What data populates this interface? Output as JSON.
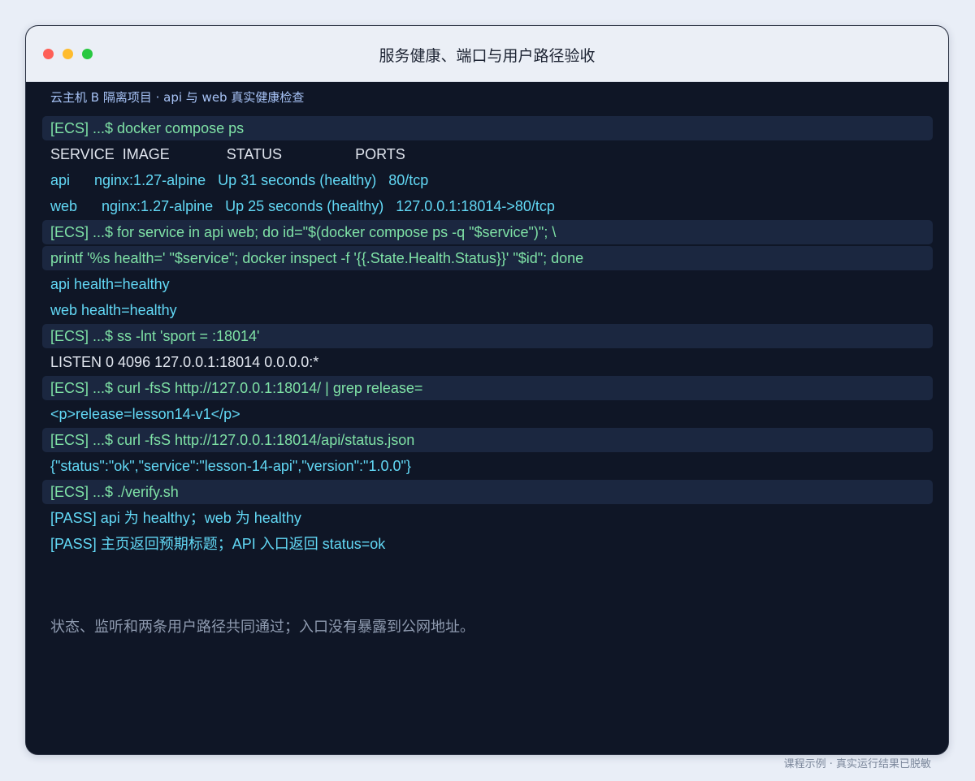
{
  "window": {
    "title": "服务健康、端口与用户路径验收"
  },
  "terminal": {
    "subtitle": "云主机 B 隔离项目 · api 与 web 真实健康检查",
    "lines": [
      {
        "kind": "cmd",
        "text": "[ECS] ...$ docker compose ps"
      },
      {
        "kind": "header",
        "text": "SERVICE  IMAGE              STATUS                  PORTS"
      },
      {
        "kind": "out",
        "text": "api      nginx:1.27-alpine   Up 31 seconds (healthy)   80/tcp"
      },
      {
        "kind": "out",
        "text": "web      nginx:1.27-alpine   Up 25 seconds (healthy)   127.0.0.1:18014->80/tcp"
      },
      {
        "kind": "cmd",
        "text": "[ECS] ...$ for service in api web; do id=\"$(docker compose ps -q \"$service\")\"; \\"
      },
      {
        "kind": "cmd",
        "text": "printf '%s health=' \"$service\"; docker inspect -f '{{.State.Health.Status}}' \"$id\"; done"
      },
      {
        "kind": "out",
        "text": "api health=healthy"
      },
      {
        "kind": "out",
        "text": "web health=healthy"
      },
      {
        "kind": "cmd",
        "text": "[ECS] ...$ ss -lnt 'sport = :18014'"
      },
      {
        "kind": "plain",
        "text": "LISTEN 0 4096 127.0.0.1:18014 0.0.0.0:*"
      },
      {
        "kind": "cmd",
        "text": "[ECS] ...$ curl -fsS http://127.0.0.1:18014/ | grep release="
      },
      {
        "kind": "out",
        "text": "<p>release=lesson14-v1</p>"
      },
      {
        "kind": "cmd",
        "text": "[ECS] ...$ curl -fsS http://127.0.0.1:18014/api/status.json"
      },
      {
        "kind": "out",
        "text": "{\"status\":\"ok\",\"service\":\"lesson-14-api\",\"version\":\"1.0.0\"}"
      },
      {
        "kind": "cmd",
        "text": "[ECS] ...$ ./verify.sh"
      },
      {
        "kind": "pass",
        "text": "[PASS] api 为 healthy；web 为 healthy"
      },
      {
        "kind": "pass",
        "text": "[PASS] 主页返回预期标题；API 入口返回 status=ok"
      }
    ],
    "note": "状态、监听和两条用户路径共同通过；入口没有暴露到公网地址。"
  },
  "footer": {
    "caption": "课程示例 · 真实运行结果已脱敏"
  },
  "colors": {
    "background": "#e9eef7",
    "terminal_bg": "#0f1626",
    "command_bg": "#1b2740",
    "command_text": "#7fe2a6",
    "output_text": "#62d8f5",
    "plain_text": "#e1e6ef",
    "note_text": "#8f9bb0"
  }
}
